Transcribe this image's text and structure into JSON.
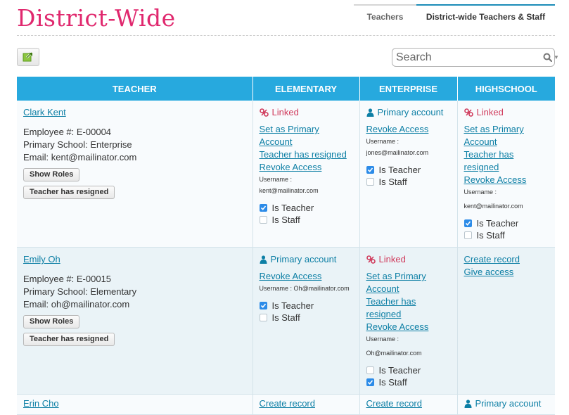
{
  "header": {
    "title": "District-Wide",
    "tabs": [
      {
        "label": "Teachers",
        "active": false
      },
      {
        "label": "District-wide Teachers & Staff",
        "active": true
      }
    ]
  },
  "toolbar": {
    "export_icon": "external-link-icon",
    "search": {
      "placeholder": "Search",
      "value": ""
    }
  },
  "colors": {
    "title": "#e0286e",
    "header_bg": "#27a9de",
    "link": "#0d7fa5",
    "linked": "#d03b5c"
  },
  "table": {
    "columns": [
      "TEACHER",
      "ELEMENTARY",
      "ENTERPRISE",
      "HIGHSCHOOL"
    ],
    "rows": [
      {
        "teacher": {
          "name": "Clark Kent",
          "employee": "Employee #: E-00004",
          "school": "Primary School: Enterprise",
          "email": "Email: kent@mailinator.com",
          "show_roles": "Show Roles",
          "resigned": "Teacher has resigned"
        },
        "elementary": {
          "status": "Linked",
          "set_primary": "Set as Primary Account",
          "resigned": "Teacher has resigned",
          "revoke": "Revoke Access",
          "username": "Username : kent@mailinator.com",
          "is_teacher": "Is Teacher",
          "is_teacher_checked": true,
          "is_staff": "Is Staff",
          "is_staff_checked": false
        },
        "enterprise": {
          "status": "Primary account",
          "revoke": "Revoke Access",
          "username_label": "Username :",
          "username_value": "jones@mailinator.com",
          "is_teacher": "Is Teacher",
          "is_teacher_checked": true,
          "is_staff": "Is Staff",
          "is_staff_checked": false
        },
        "highschool": {
          "status": "Linked",
          "set_primary": "Set as Primary Account",
          "resigned": "Teacher has resigned",
          "revoke": "Revoke Access",
          "username_label": "Username :",
          "username_value": "kent@mailinator.com",
          "is_teacher": "Is Teacher",
          "is_teacher_checked": true,
          "is_staff": "Is Staff",
          "is_staff_checked": false
        }
      },
      {
        "teacher": {
          "name": "Emily Oh",
          "employee": "Employee #: E-00015",
          "school": "Primary School: Elementary",
          "email": "Email: oh@mailinator.com",
          "show_roles": "Show Roles",
          "resigned": "Teacher has resigned"
        },
        "elementary": {
          "status": "Primary account",
          "revoke": "Revoke Access",
          "username": "Username : Oh@mailinator.com",
          "is_teacher": "Is Teacher",
          "is_teacher_checked": true,
          "is_staff": "Is Staff",
          "is_staff_checked": false
        },
        "enterprise": {
          "status": "Linked",
          "set_primary": "Set as Primary Account",
          "resigned": "Teacher has resigned",
          "revoke": "Revoke Access",
          "username_label": "Username :",
          "username_value": "Oh@mailinator.com",
          "is_teacher": "Is Teacher",
          "is_teacher_checked": false,
          "is_staff": "Is Staff",
          "is_staff_checked": true
        },
        "highschool": {
          "create": "Create record",
          "give": "Give access"
        }
      },
      {
        "teacher": {
          "name": "Erin Cho"
        },
        "elementary": {
          "create": "Create record"
        },
        "enterprise": {
          "create": "Create record"
        },
        "highschool": {
          "status": "Primary account"
        }
      }
    ]
  }
}
